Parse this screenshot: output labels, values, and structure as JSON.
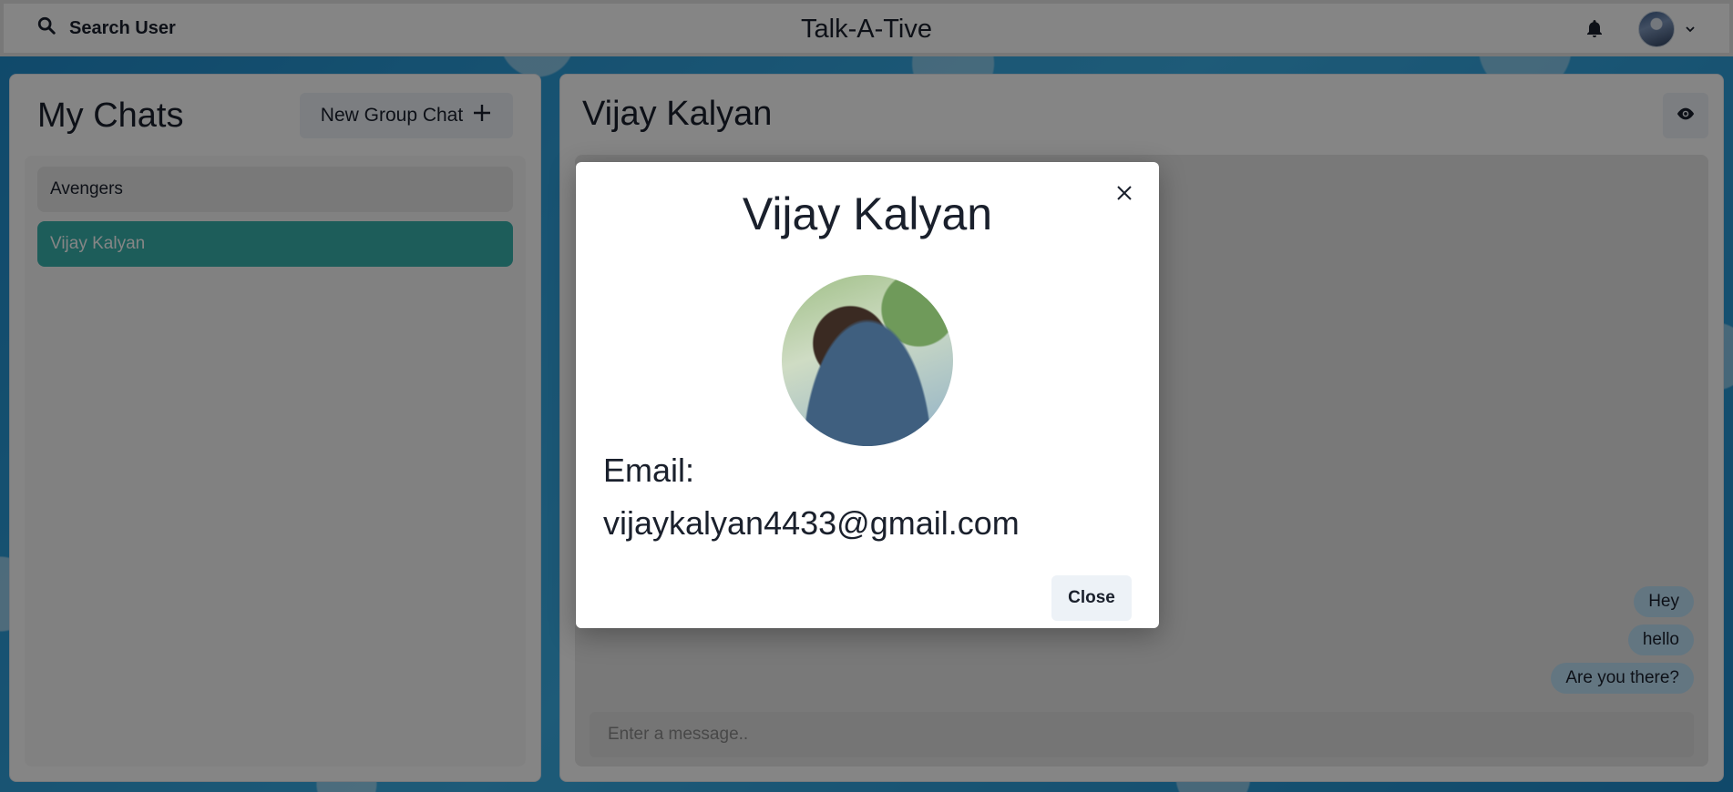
{
  "header": {
    "search_label": "Search User",
    "app_title": "Talk-A-Tive",
    "icons": {
      "search": "search-icon",
      "bell": "bell-icon",
      "chevron": "chevron-down-icon"
    }
  },
  "sidebar": {
    "title": "My Chats",
    "new_group_label": "New Group Chat",
    "chats": [
      {
        "name": "Avengers",
        "active": false
      },
      {
        "name": "Vijay Kalyan",
        "active": true
      }
    ],
    "accent_color": "#38b2ac"
  },
  "chat": {
    "title": "Vijay Kalyan",
    "messages": [
      "Hey",
      "hello",
      "Are you there?"
    ],
    "input_placeholder": "Enter a message.."
  },
  "modal": {
    "title": "Vijay Kalyan",
    "email_label": "Email:",
    "email": "vijaykalyan4433@gmail.com",
    "close_label": "Close"
  }
}
